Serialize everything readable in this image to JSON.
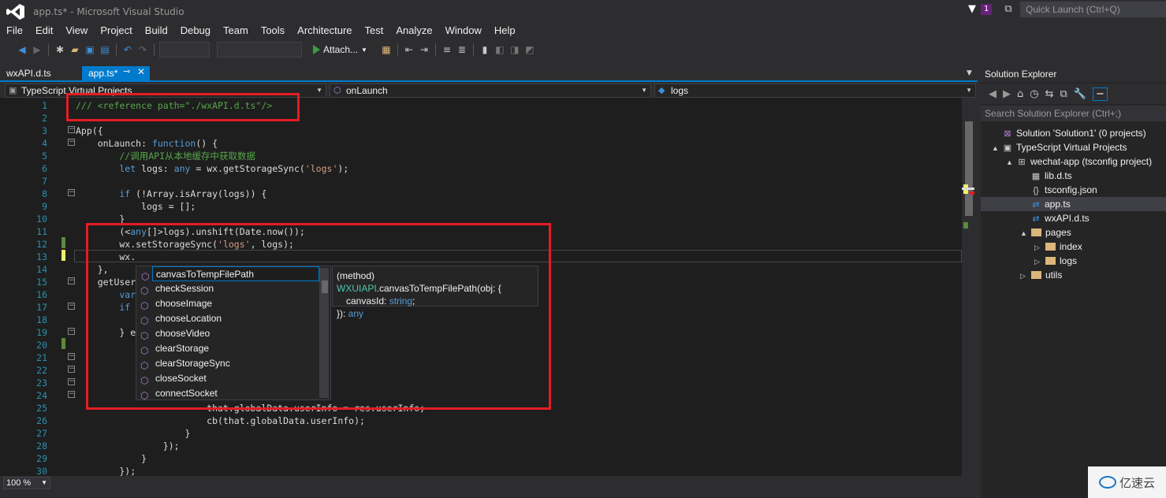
{
  "window": {
    "title": "app.ts* - Microsoft Visual Studio",
    "notification_count": "1",
    "quick_launch_placeholder": "Quick Launch (Ctrl+Q)"
  },
  "menu": [
    "File",
    "Edit",
    "View",
    "Project",
    "Build",
    "Debug",
    "Team",
    "Tools",
    "Architecture",
    "Test",
    "Analyze",
    "Window",
    "Help"
  ],
  "toolbar": {
    "attach_label": "Attach..."
  },
  "tabs": [
    {
      "label": "wxAPI.d.ts",
      "active": false
    },
    {
      "label": "app.ts*",
      "active": true
    }
  ],
  "navbar": {
    "project": "TypeScript Virtual Projects",
    "member": "onLaunch",
    "symbol": "logs"
  },
  "line_numbers": [
    "1",
    "2",
    "3",
    "4",
    "5",
    "6",
    "7",
    "8",
    "9",
    "10",
    "11",
    "12",
    "13",
    "14",
    "15",
    "16",
    "17",
    "18",
    "19",
    "20",
    "21",
    "22",
    "23",
    "24",
    "25",
    "26",
    "27",
    "28",
    "29",
    "30"
  ],
  "code": {
    "l1": "/// <reference path=\"./wxAPI.d.ts\"/>",
    "l3": "App({",
    "l4a": "    onLaunch: ",
    "l4b": "function",
    "l4c": "() {",
    "l5": "        //调用API从本地缓存中获取数据",
    "l6a": "        let",
    "l6b": " logs: ",
    "l6c": "any",
    "l6d": " = wx.getStorageSync(",
    "l6e": "'logs'",
    "l6f": ");",
    "l8a": "        if",
    "l8b": " (!Array.isArray(logs)) {",
    "l9": "            logs = [];",
    "l10": "        }",
    "l11a": "        (<",
    "l11b": "any",
    "l11c": "[]>logs).unshift(Date.now());",
    "l12a": "        wx.setStorageSync(",
    "l12b": "'logs'",
    "l12c": ", logs);",
    "l13": "        wx.",
    "l14": "    },",
    "l15": "    getUser",
    "l16": "        var",
    "l17": "        if",
    "l19": "        } e",
    "l25": "                        that.globalData.userInfo = res.userInfo;",
    "l26": "                        cb(that.globalData.userInfo);",
    "l27": "                    }",
    "l28": "                });",
    "l29": "            }",
    "l30": "        });"
  },
  "intellisense": {
    "items": [
      "canvasToTempFilePath",
      "checkSession",
      "chooseImage",
      "chooseLocation",
      "chooseVideo",
      "clearStorage",
      "clearStorageSync",
      "closeSocket",
      "connectSocket"
    ],
    "selected_index": 0
  },
  "tooltip": {
    "prefix": "(method) ",
    "type": "WXUIAPI",
    "method": ".canvasToTempFilePath(obj: {",
    "param": "canvasId: ",
    "param_type": "string",
    "param_end": ";",
    "ret": "}): ",
    "ret_type": "any"
  },
  "zoom": "100 %",
  "solution_explorer": {
    "title": "Solution Explorer",
    "search_placeholder": "Search Solution Explorer (Ctrl+;)",
    "nodes": [
      {
        "label": "Solution 'Solution1' (0 projects)",
        "depth": 0
      },
      {
        "label": "TypeScript Virtual Projects",
        "depth": 1
      },
      {
        "label": "wechat-app (tsconfig project)",
        "depth": 2
      },
      {
        "label": "lib.d.ts",
        "depth": 3
      },
      {
        "label": "tsconfig.json",
        "depth": 3
      },
      {
        "label": "app.ts",
        "depth": 3,
        "selected": true
      },
      {
        "label": "wxAPI.d.ts",
        "depth": 3
      },
      {
        "label": "pages",
        "depth": 3
      },
      {
        "label": "index",
        "depth": 4
      },
      {
        "label": "logs",
        "depth": 4
      },
      {
        "label": "utils",
        "depth": 3
      }
    ]
  },
  "watermark": "亿速云",
  "colors": {
    "accent": "#007acc",
    "highlight_box": "#e51c23",
    "editor_bg": "#1e1e1e"
  }
}
